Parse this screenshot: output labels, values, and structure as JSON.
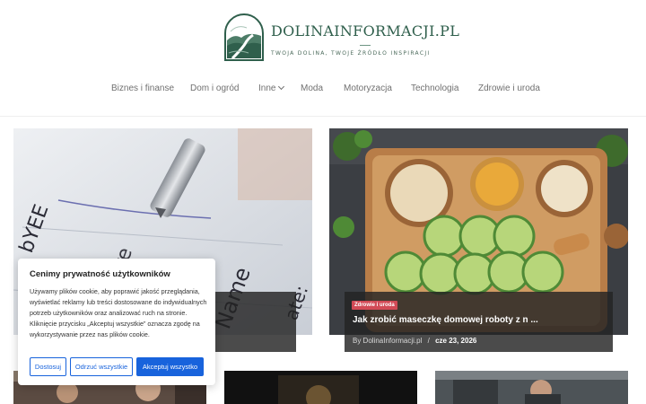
{
  "site": {
    "name": "DOLINAINFORMACJI.PL",
    "tagline": "TWOJA DOLINA, TWOJE ŹRÓDŁO INSPIRACJI",
    "logo_icon": "valley-landscape-icon"
  },
  "nav": {
    "items": [
      {
        "label": "Biznes i finanse"
      },
      {
        "label": "Dom i ogród"
      },
      {
        "label": "Inne",
        "icon": "chevron-down-icon"
      },
      {
        "label": "Moda"
      },
      {
        "label": "Motoryzacja"
      },
      {
        "label": "Technologia"
      },
      {
        "label": "Zdrowie i uroda"
      }
    ]
  },
  "posts": [
    {
      "image": "contract-signing-pen"
    },
    {
      "image": "cucumber-oats-honey-tray",
      "category": "Zdrowie i uroda",
      "title": "Jak zrobić maseczkę domowej roboty z n ...",
      "author": "By DolinaInformacji.pl",
      "separator": "/",
      "date": "cze 23, 2026"
    }
  ],
  "cookie": {
    "title": "Cenimy prywatność użytkowników",
    "text": "Używamy plików cookie, aby poprawić jakość przeglądania, wyświetlać reklamy lub treści dostosowane do indywidualnych potrzeb użytkowników oraz analizować ruch na stronie. Kliknięcie przycisku „Akceptuj wszystkie” oznacza zgodę na wykorzystywanie przez nas plików cookie.",
    "buttons": {
      "customize": "Dostosuj",
      "reject": "Odrzuć wszystkie",
      "accept": "Akceptuj wszystko"
    },
    "accent_color": "#1863dc"
  },
  "colors": {
    "brand": "#2f5f4c",
    "badge": "#d24a56"
  }
}
